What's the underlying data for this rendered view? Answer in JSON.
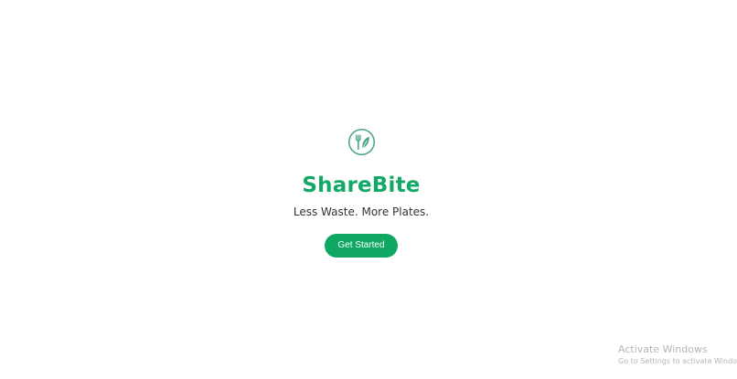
{
  "app": {
    "name": "ShareBite",
    "tagline": "Less Waste. More Plates.",
    "logo_icon": "fork-leaf-icon",
    "brand_color": "#12a865"
  },
  "cta": {
    "label": "Get Started",
    "color": "#0fa862"
  },
  "watermark": {
    "title": "Activate Windows",
    "subtitle": "Go to Settings to activate Windows."
  }
}
